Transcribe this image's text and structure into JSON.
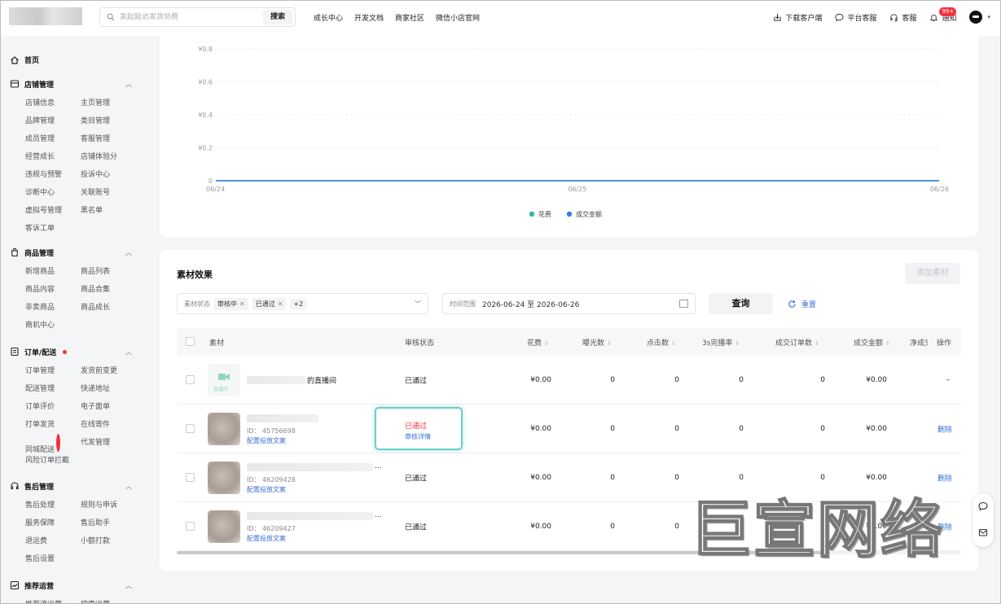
{
  "header": {
    "search_placeholder": "发起延迟发货协商",
    "search_button": "搜索",
    "nav": [
      "成长中心",
      "开发文档",
      "商家社区",
      "微信小店官网"
    ],
    "download": "下载客户端",
    "platform_service": "平台客服",
    "service": "客服",
    "notice": "通知",
    "notice_badge": "99+"
  },
  "sidebar": {
    "home": "首页",
    "groups": [
      {
        "title": "店铺管理",
        "items": [
          "店铺信息",
          "主页管理",
          "品牌管理",
          "类目管理",
          "成员管理",
          "客服管理",
          "经营成长",
          "店铺体验分",
          "违规与预警",
          "投诉中心",
          "诊断中心",
          "关联账号",
          "虚拟号管理",
          "黑名单",
          "客诉工单"
        ]
      },
      {
        "title": "商品管理",
        "items": [
          "新增商品",
          "商品列表",
          "商品内容",
          "商品合集",
          "非卖商品",
          "商品成长",
          "商机中心"
        ]
      },
      {
        "title": "订单/配送",
        "items": [
          "订单管理",
          "发货前变更",
          "配送管理",
          "快递地址",
          "订单评价",
          "电子面单",
          "打单发货",
          "在线寄件",
          "同城配送",
          "代发管理",
          "风险订单拦截"
        ]
      },
      {
        "title": "售后管理",
        "items": [
          "售后处理",
          "规则与申诉",
          "服务保障",
          "售后助手",
          "退运费",
          "小额打款",
          "售后设置"
        ]
      },
      {
        "title": "推荐运营",
        "items": [
          "推荐流运营",
          "搜索运营"
        ]
      }
    ]
  },
  "chart_data": {
    "type": "line",
    "x": [
      "06/24",
      "06/25",
      "06/26"
    ],
    "series": [
      {
        "name": "花费",
        "values": [
          0,
          0,
          0
        ],
        "color": "#2fb9a4"
      },
      {
        "name": "成交金额",
        "values": [
          0,
          0,
          0
        ],
        "color": "#3b7be0"
      }
    ],
    "yticks": [
      "0",
      "¥0.2",
      "¥0.4",
      "¥0.6",
      "¥0.8"
    ],
    "ylim": [
      0,
      0.8
    ],
    "legend": "bottom"
  },
  "material": {
    "title": "素材效果",
    "add_button": "添加素材",
    "filter_label": "素材状态",
    "tags": [
      "审核中",
      "已通过",
      "+2"
    ],
    "time_label": "时间范围",
    "date_range": "2026-06-24 至 2026-06-26",
    "query": "查询",
    "reset": "重置",
    "columns": [
      "素材",
      "审核状态",
      "花费",
      "曝光数",
      "点击数",
      "3s完播率",
      "成交订单数",
      "成交金额",
      "净成交",
      "操作"
    ],
    "rows": [
      {
        "name": "的直播间",
        "id": "",
        "link": "",
        "status": "已通过",
        "cost": "¥0.00",
        "exposure": "0",
        "clicks": "0",
        "rate": "0",
        "orders": "0",
        "amount": "¥0.00",
        "op": "–"
      },
      {
        "name": "",
        "id": "ID： 45756698",
        "link": "配置投放文案",
        "status": "已通过",
        "detail": "审核详情",
        "cost": "¥0.00",
        "exposure": "0",
        "clicks": "0",
        "rate": "0",
        "orders": "0",
        "amount": "¥0.00",
        "op": "删除"
      },
      {
        "name": "...",
        "id": "ID： 46209428",
        "link": "配置投放文案",
        "status": "已通过",
        "cost": "¥0.00",
        "exposure": "0",
        "clicks": "0",
        "rate": "0",
        "orders": "0",
        "amount": "¥0.00",
        "op": "删除"
      },
      {
        "name": "...",
        "id": "ID： 46209427",
        "link": "配置投放文案",
        "status": "已通过",
        "cost": "¥0.00",
        "exposure": "0",
        "clicks": "0",
        "rate": "0",
        "orders": "0",
        "amount": "¥0.00",
        "op": "删除"
      }
    ],
    "live_thumb_label": "直播间"
  },
  "watermark": "巨宣网络"
}
